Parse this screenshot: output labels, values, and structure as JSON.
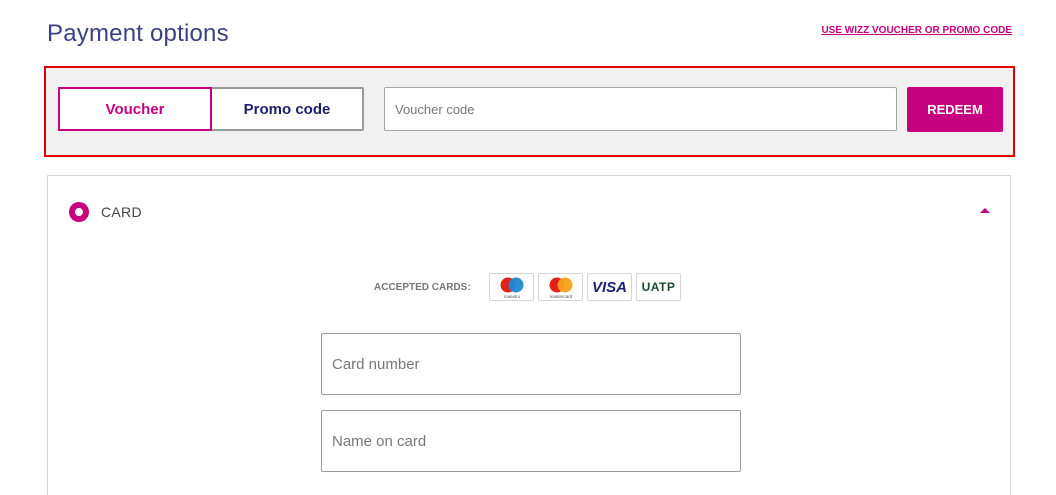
{
  "header": {
    "title": "Payment options",
    "promo_link": "USE WIZZ VOUCHER OR PROMO CODE"
  },
  "voucher": {
    "tabs": [
      {
        "label": "Voucher",
        "active": true
      },
      {
        "label": "Promo code",
        "active": false
      }
    ],
    "input_placeholder": "Voucher code",
    "input_value": "",
    "redeem_label": "REDEEM"
  },
  "payment": {
    "method_label": "CARD",
    "selected": true,
    "accepted_label": "ACCEPTED CARDS:",
    "card_logos": [
      {
        "icon": "maestro-logo-icon",
        "text": "maestro"
      },
      {
        "icon": "mastercard-logo-icon",
        "text": "mastercard"
      },
      {
        "icon": "visa-logo-icon",
        "text": "VISA"
      },
      {
        "icon": "uatp-logo-icon",
        "text": "UATP"
      }
    ],
    "card_number_placeholder": "Card number",
    "name_on_card_placeholder": "Name on card"
  },
  "colors": {
    "brand": "#c6007e",
    "title": "#3a3f86",
    "highlight_border": "#e00000"
  }
}
